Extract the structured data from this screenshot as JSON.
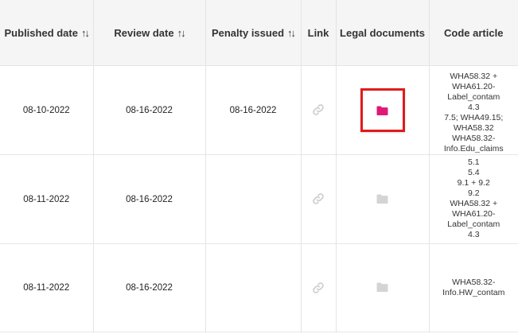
{
  "headers": {
    "published": "Published date",
    "review": "Review date",
    "penalty": "Penalty issued",
    "link": "Link",
    "legal": "Legal documents",
    "code": "Code article",
    "sort_glyph": "↑↓"
  },
  "colors": {
    "folder_active": "#e0187a",
    "folder_inactive": "#d4d4d4",
    "link_icon": "#cfcfcf",
    "highlight": "#e01b1b"
  },
  "rows": [
    {
      "published": "08-10-2022",
      "review": "08-16-2022",
      "penalty": "08-16-2022",
      "code_lines": [
        "WHA58.32 +",
        "WHA61.20-",
        "Label_contam",
        "4.3",
        "7.5; WHA49.15;",
        "WHA58.32",
        "WHA58.32-",
        "Info.Edu_claims"
      ]
    },
    {
      "published": "08-11-2022",
      "review": "08-16-2022",
      "penalty": "",
      "code_lines": [
        "5.1",
        "5.4",
        "9.1 + 9.2",
        "9.2",
        "WHA58.32 +",
        "WHA61.20-",
        "Label_contam",
        "4.3"
      ]
    },
    {
      "published": "08-11-2022",
      "review": "08-16-2022",
      "penalty": "",
      "code_lines": [
        "WHA58.32-",
        "Info.HW_contam"
      ]
    }
  ]
}
